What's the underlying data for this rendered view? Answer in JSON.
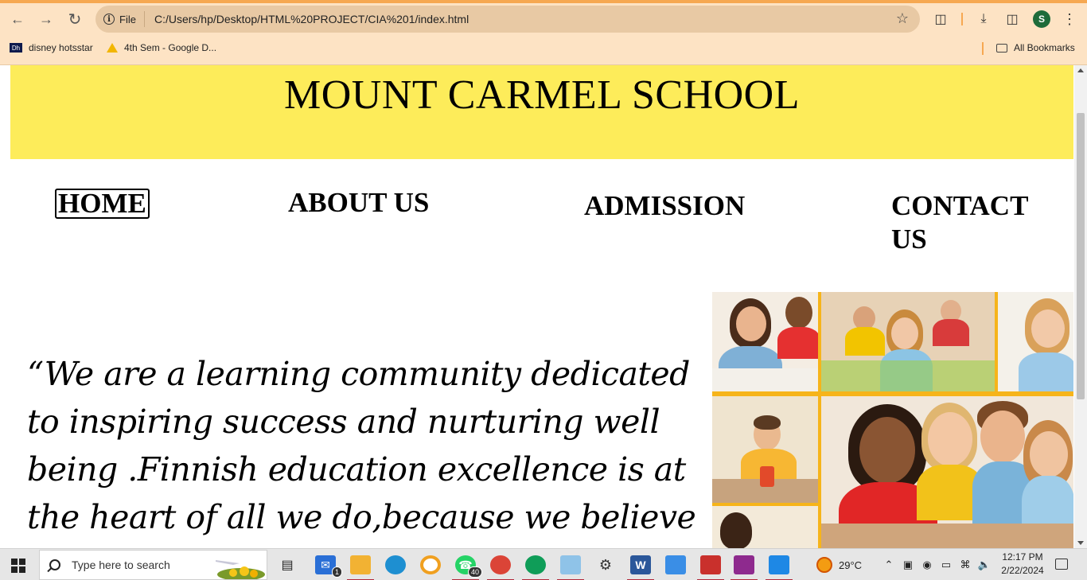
{
  "browser": {
    "url_chip": "File",
    "url": "C:/Users/hp/Desktop/HTML%20PROJECT/CIA%201/index.html",
    "profile_initial": "S",
    "bookmarks": [
      {
        "label": "disney hotsstar",
        "icon": "hotstar-icon"
      },
      {
        "label": "4th Sem - Google D...",
        "icon": "google-drive-icon"
      }
    ],
    "all_bookmarks": "All Bookmarks"
  },
  "page": {
    "school_name": "MOUNT CARMEL SCHOOL",
    "header_color": "#fdec5a",
    "nav": {
      "home": "HOME",
      "about": "ABOUT US",
      "admission": "ADMISSION",
      "contact": "CONTACT US"
    },
    "quote": "“We are a learning community dedicated to inspiring success and nurturing well being .Finnish education excellence is at the heart of all we do,because we believe"
  },
  "taskbar": {
    "search_placeholder": "Type here to search",
    "mail_badge": "1",
    "whatsapp_badge": "40",
    "weather": "29°C",
    "time": "12:17 PM",
    "date": "2/22/2024"
  }
}
